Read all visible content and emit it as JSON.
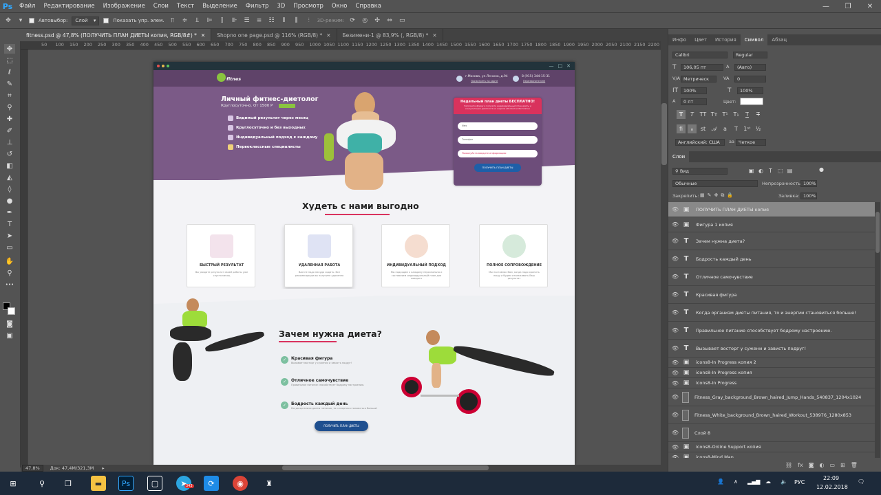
{
  "app": {
    "logo": "Ps"
  },
  "menu": [
    "Файл",
    "Редактирование",
    "Изображение",
    "Слои",
    "Текст",
    "Выделение",
    "Фильтр",
    "3D",
    "Просмотр",
    "Окно",
    "Справка"
  ],
  "options": {
    "autoselect_label": "Автовыбор:",
    "autoselect_value": "Слой",
    "show_controls_label": "Показать упр. элем.",
    "mode_3d": "3D-режим:"
  },
  "tabs": [
    "fitness.psd @ 47,8% (ПОЛУЧИТЬ ПЛАН ДИЕТЫ копия, RGB/8#) *",
    "Shopno one page.psd @ 116% (RGB/8) *",
    "Безимени-1 @ 83,9% (, RGB/8) *"
  ],
  "ruler": [
    "50",
    "100",
    "150",
    "200",
    "250",
    "300",
    "350",
    "400",
    "450",
    "500",
    "550",
    "600",
    "650",
    "700",
    "750",
    "800",
    "850",
    "900",
    "950",
    "1000",
    "1050",
    "1100",
    "1150",
    "1200",
    "1250",
    "1300",
    "1350",
    "1400",
    "1450",
    "1500",
    "1550",
    "1600",
    "1650",
    "1700",
    "1750",
    "1800",
    "1850",
    "1900",
    "1950",
    "2000",
    "2050",
    "2100",
    "2150",
    "2200"
  ],
  "status": {
    "zoom": "47,8%",
    "doc": "Док: 47,4M/321,3M"
  },
  "site": {
    "logo": "fitnes",
    "address": "г.Москва, ул.Ленина, д.94",
    "address_link": "Посмотреть на карте",
    "phone": "8 (915) 344-15-31",
    "phone_link": "Перезвоните мне",
    "hero_title": "Личный фитнес-диетолог",
    "hero_sub": "Круглосуточно. От 1500 Р",
    "hero_badge": "",
    "hero_items": [
      "Видимый результат через месяц",
      "Круглосуточно и без выходных",
      "Индивидуальный подход к каждому",
      "Первоклассные специалисты"
    ],
    "form_title": "Недельный план диеты БЕСПЛАТНО!",
    "form_sub": "Заполните форму и получите индивидуальный план диеты и консультацию диетолога на неделю абсолютно бесплатно",
    "form_name": "Имя",
    "form_phone": "Телефон",
    "form_info": "Пожалуйста введите информацию",
    "form_button": "ПОЛУЧИТЬ ПЛАН ДИЕТЫ",
    "sec1_title": "Худеть с нами выгодно",
    "cards": [
      {
        "title": "БЫСТРЫЙ РЕЗУЛЬТАТ",
        "desc": "Вы увидите результат своей работы уже спустя месяц"
      },
      {
        "title": "УДАЛЕННАЯ РАБОТА",
        "desc": "Вам не надо никуда ходить. Все рекомендации вы получите удаленно"
      },
      {
        "title": "ИНДИВИДУАЛЬНЫЙ ПОДХОД",
        "desc": "Мы подходим к каждому персонально и составляем индивидуальный план для каждого"
      },
      {
        "title": "ПОЛНОЕ СОПРОВОЖДЕНИЕ",
        "desc": "Мы наставник Вам, когда надо хранить пищу и будем отслеживать Ваш результат"
      }
    ],
    "sec2_title": "Зачем нужна диета?",
    "benefits": [
      {
        "title": "Красивая фигура",
        "desc": "Вызывает восторг у сужених и зависть подруг!"
      },
      {
        "title": "Отличное самочувствие",
        "desc": "Правильное питание способствует бодрому настроению."
      },
      {
        "title": "Бодрость каждый день",
        "desc": "Когда организм диеты питания, то и энергии становиться больше!"
      }
    ],
    "button2": "ПОЛУЧИТЬ ПЛАН ДИЕТЫ"
  },
  "char_panel": {
    "tabs": [
      "Инфо",
      "Цвет",
      "История",
      "Символ",
      "Абзац"
    ],
    "font": "Calibri",
    "style": "Regular",
    "size": "106,05 пт",
    "leading": "(Авто)",
    "kerning": "Метрическ",
    "tracking": "0",
    "vscale": "100%",
    "hscale": "100%",
    "baseline": "0 пт",
    "color_label": "Цвет:",
    "language": "Английский: США",
    "aa_prefix": "aa",
    "aa": "Четкое"
  },
  "layers_panel": {
    "tab": "Слои",
    "filter": "Вид",
    "blend": "Обычные",
    "opacity_label": "Непрозрачность:",
    "opacity": "100%",
    "lock_label": "Закрепить:",
    "fill_label": "Заливка:",
    "fill": "100%",
    "layers": [
      {
        "name": "ПОЛУЧИТЬ ПЛАН ДИЕТЫ копия",
        "type": "smart",
        "selected": true
      },
      {
        "name": "Фигура 1 копия",
        "type": "smart"
      },
      {
        "name": "Зачем нужна диета?",
        "type": "text"
      },
      {
        "name": "Бодрость каждый день",
        "type": "text"
      },
      {
        "name": "Отличное самочувствие",
        "type": "text"
      },
      {
        "name": "Красивая фигура",
        "type": "text"
      },
      {
        "name": "Когда организм диеты питания, то и энергии становиться больше!",
        "type": "text"
      },
      {
        "name": "Правильное питание способствует бодрому настроению.",
        "type": "text"
      },
      {
        "name": "Вызывает восторг у сужени и зависть подруг!",
        "type": "text"
      },
      {
        "name": "icons8-In Progress копия 2",
        "type": "smart"
      },
      {
        "name": "icons8-In Progress копия",
        "type": "smart"
      },
      {
        "name": "icons8-In Progress",
        "type": "smart"
      },
      {
        "name": "Fitness_Gray_background_Brown_haired_Jump_Hands_540837_1204x1024",
        "type": "image"
      },
      {
        "name": "Fitness_White_background_Brown_haired_Workout_538976_1280x853",
        "type": "image"
      },
      {
        "name": "Слой 8",
        "type": "image"
      },
      {
        "name": "icons8-Online Support копия",
        "type": "smart"
      },
      {
        "name": "icons8-Mind Map",
        "type": "smart"
      }
    ]
  },
  "taskbar": {
    "lang": "РУС",
    "time": "22:09",
    "date": "12.02.2018",
    "badge": "343"
  }
}
